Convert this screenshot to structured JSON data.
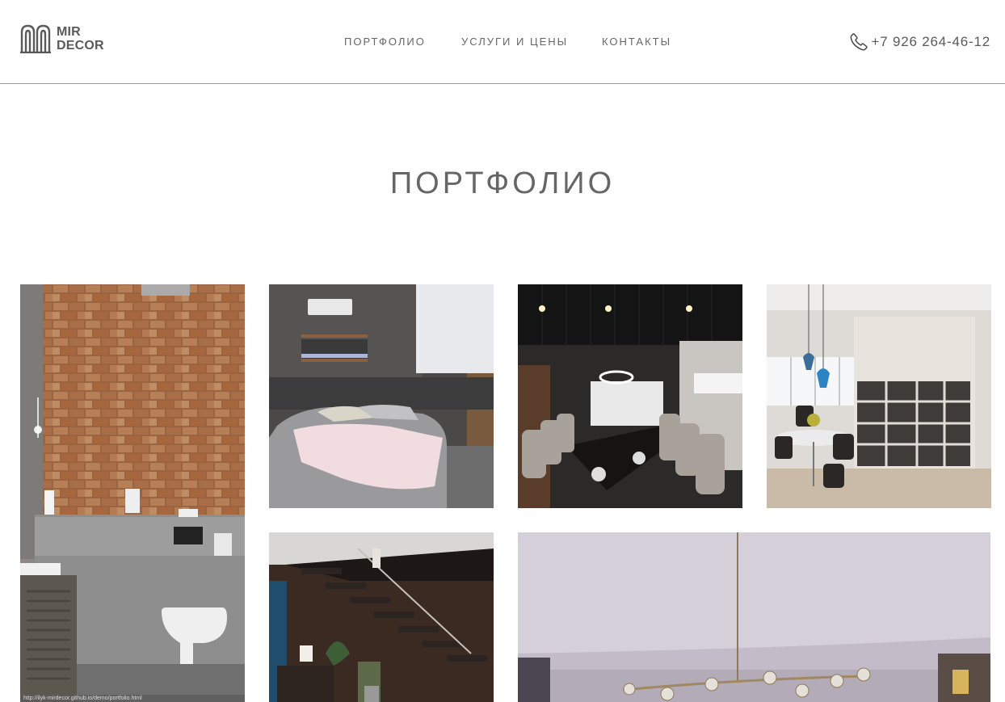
{
  "brand": {
    "line1": "MIR",
    "line2": "DECOR",
    "logo_icon": "arches-logo-icon"
  },
  "nav": {
    "items": [
      {
        "label": "ПОРТФОЛИО"
      },
      {
        "label": "УСЛУГИ И ЦЕНЫ"
      },
      {
        "label": "КОНТАКТЫ"
      }
    ]
  },
  "contact": {
    "phone": "+7 926 264-46-12",
    "phone_icon": "phone-icon"
  },
  "page": {
    "title": "ПОРТФОЛИО"
  },
  "portfolio": {
    "items": [
      {
        "name": "portfolio-bathroom-brick-wall"
      },
      {
        "name": "portfolio-bedroom"
      },
      {
        "name": "portfolio-dining-room"
      },
      {
        "name": "portfolio-kitchen-dining"
      },
      {
        "name": "portfolio-staircase"
      },
      {
        "name": "portfolio-living-room-chandelier"
      }
    ]
  },
  "status_bar": {
    "url": "http://ilyk-mirdecor.github.io/demo/portfolio.html"
  },
  "colors": {
    "text": "#666666",
    "divider": "#9a9a9a",
    "background": "#ffffff"
  }
}
